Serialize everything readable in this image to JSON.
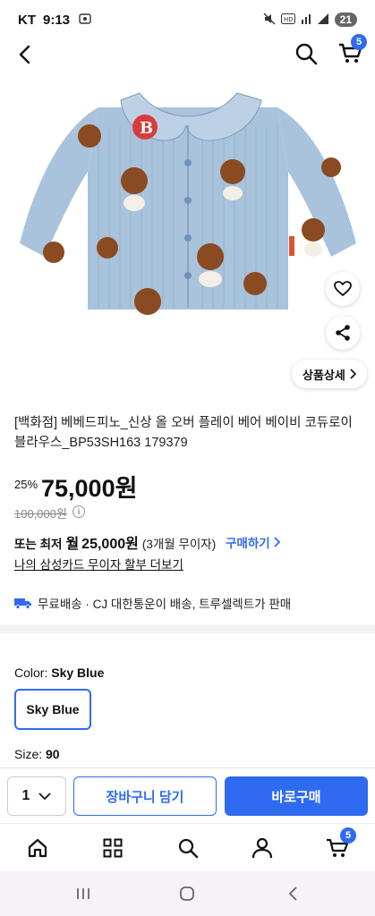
{
  "status_bar": {
    "carrier": "KT",
    "time": "9:13",
    "battery": "21"
  },
  "header": {
    "cart_count": "5"
  },
  "product": {
    "image_alt": "Sky Blue corduroy blouse with bear print",
    "detail_button": "상품상세",
    "title": "[백화점] 베베드피노_신상 올 오버 플레이 베어 베이비 코듀로이 블라우스_BP53SH163 179379",
    "discount": "25%",
    "price": "75,000원",
    "original_price": "100,000원",
    "installment_prefix": "또는 최저",
    "installment_monthly": "월",
    "installment_amount": "25,000원",
    "installment_months": "(3개월 무이자)",
    "buy_link": "구매하기",
    "card_link": "나의 삼성카드 무이자 할부 더보기",
    "shipping": "무료배송 · CJ 대한통운이 배송, 트루셀렉트가 판매"
  },
  "options": {
    "color_label": "Color:",
    "color_value": "Sky Blue",
    "color_option": "Sky Blue",
    "size_label": "Size:",
    "size_value": "90"
  },
  "purchase_bar": {
    "quantity": "1",
    "add_to_cart": "장바구니 담기",
    "buy_now": "바로구매"
  },
  "tab_bar": {
    "cart_count": "5"
  },
  "colors": {
    "accent": "#2f6bf0",
    "blouse": "#a9c3dc"
  }
}
